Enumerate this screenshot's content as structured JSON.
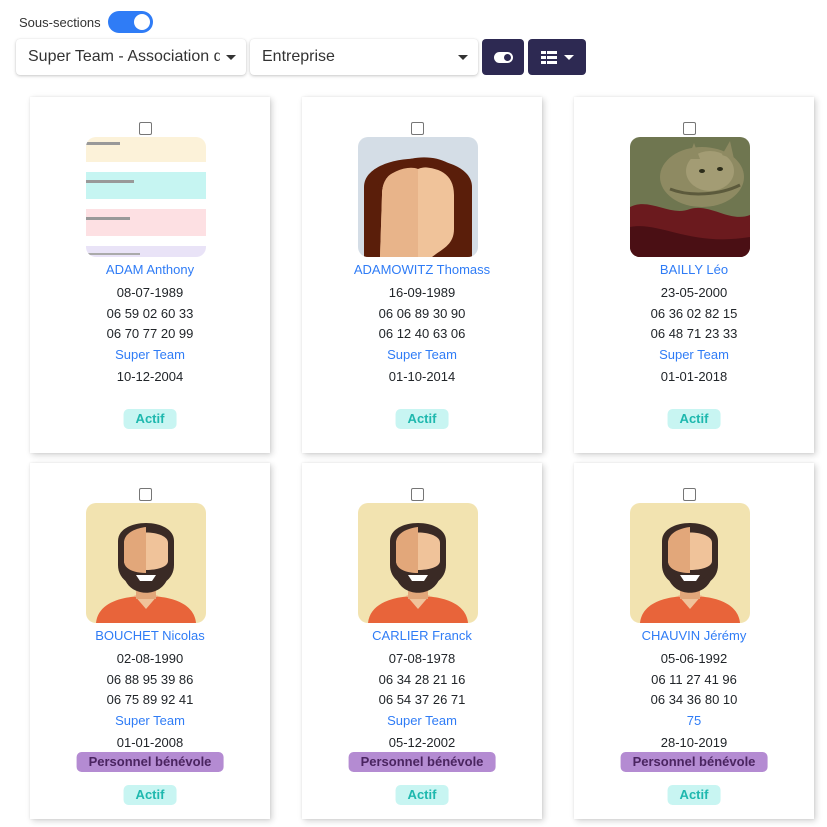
{
  "toolbar": {
    "subsections_label": "Sous-sections",
    "team_select": "Super Team - Association d",
    "entity_select": "Entreprise"
  },
  "colors": {
    "accent": "#2f7cf6",
    "dark_button": "#2d2952",
    "actif_bg": "#c8f5f2",
    "actif_text": "#1eb8ae",
    "role_bg": "#b48bd2"
  },
  "members": [
    {
      "name": "ADAM Anthony",
      "birth": "08-07-1989",
      "phone1": "06 59 02 60 33",
      "phone2": "06 70 77 20 99",
      "team": "Super Team",
      "date": "10-12-2004",
      "role": "",
      "status": "Actif",
      "avatar": "screenshot-icon"
    },
    {
      "name": "ADAMOWITZ Thomass",
      "birth": "16-09-1989",
      "phone1": "06 06 89 30 90",
      "phone2": "06 12 40 63 06",
      "team": "Super Team",
      "date": "01-10-2014",
      "role": "",
      "status": "Actif",
      "avatar": "female-avatar-icon"
    },
    {
      "name": "BAILLY Léo",
      "birth": "23-05-2000",
      "phone1": "06 36 02 82 15",
      "phone2": "06 48 71 23 33",
      "team": "Super Team",
      "date": "01-01-2018",
      "role": "",
      "status": "Actif",
      "avatar": "cat-photo-icon"
    },
    {
      "name": "BOUCHET Nicolas",
      "birth": "02-08-1990",
      "phone1": "06 88 95 39 86",
      "phone2": "06 75 89 92 41",
      "team": "Super Team",
      "date": "01-01-2008",
      "role": "Personnel bénévole",
      "status": "Actif",
      "avatar": "bearded-man-avatar-icon"
    },
    {
      "name": "CARLIER Franck",
      "birth": "07-08-1978",
      "phone1": "06 34 28 21 16",
      "phone2": "06 54 37 26 71",
      "team": "Super Team",
      "date": "05-12-2002",
      "role": "Personnel bénévole",
      "status": "Actif",
      "avatar": "bearded-man-avatar-icon"
    },
    {
      "name": "CHAUVIN Jérémy",
      "birth": "05-06-1992",
      "phone1": "06 11 27 41 96",
      "phone2": "06 34 36 80 10",
      "team": "75",
      "date": "28-10-2019",
      "role": "Personnel bénévole",
      "status": "Actif",
      "avatar": "bearded-man-avatar-icon"
    }
  ]
}
